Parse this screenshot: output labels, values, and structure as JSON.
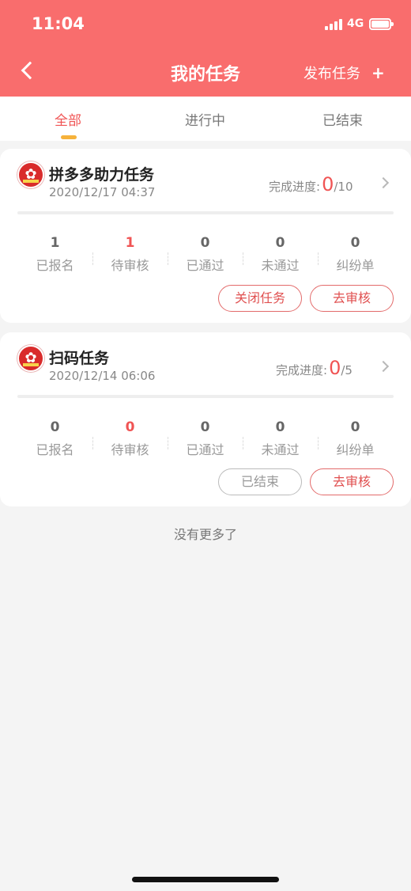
{
  "status_bar": {
    "time": "11:04",
    "network": "4G"
  },
  "nav": {
    "title": "我的任务",
    "publish_label": "发布任务",
    "publish_icon": "+"
  },
  "tabs": [
    {
      "label": "全部",
      "active": true
    },
    {
      "label": "进行中",
      "active": false
    },
    {
      "label": "已结束",
      "active": false
    }
  ],
  "tasks": [
    {
      "title": "拼多多助力任务",
      "date": "2020/12/17 04:37",
      "progress_label": "完成进度:",
      "progress_done": "0",
      "progress_total": "/10",
      "stats": [
        {
          "value": "1",
          "label": "已报名"
        },
        {
          "value": "1",
          "label": "待审核"
        },
        {
          "value": "0",
          "label": "已通过"
        },
        {
          "value": "0",
          "label": "未通过"
        },
        {
          "value": "0",
          "label": "纠纷单"
        }
      ],
      "buttons": [
        "关闭任务",
        "去审核"
      ]
    },
    {
      "title": "扫码任务",
      "date": "2020/12/14 06:06",
      "progress_label": "完成进度:",
      "progress_done": "0",
      "progress_total": "/5",
      "stats": [
        {
          "value": "0",
          "label": "已报名"
        },
        {
          "value": "0",
          "label": "待审核"
        },
        {
          "value": "0",
          "label": "已通过"
        },
        {
          "value": "0",
          "label": "未通过"
        },
        {
          "value": "0",
          "label": "纠纷单"
        }
      ],
      "buttons": [
        "已结束",
        "去审核"
      ]
    }
  ],
  "footer": {
    "no_more": "没有更多了"
  },
  "colors": {
    "header": "#f96d6d",
    "accent": "#f05454",
    "tab_indicator": "#f6b23b",
    "background": "#f4f4f4"
  }
}
